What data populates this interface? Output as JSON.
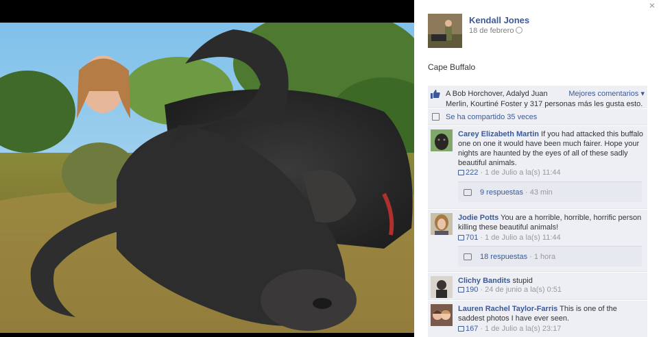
{
  "viewer": {
    "close_label": "×"
  },
  "post": {
    "author": "Kendall Jones",
    "date": "18 de febrero",
    "caption": "Cape Buffalo"
  },
  "likes": {
    "line1": "A Bob Horchover, Adalyd Juan",
    "line2": "Merlin, Kourtiné Foster y 317 personas más les gusta esto.",
    "top_comments_label": "Mejores comentarios ▾"
  },
  "shares": {
    "label": "Se ha compartido 35 veces"
  },
  "comments": [
    {
      "author": "Carey Elizabeth Martin",
      "text": " If you had attacked this buffalo one on one it would have been much fairer. Hope your nights are haunted by the eyes of all of these sadly beautiful animals.",
      "likes": "222",
      "time": " · 1 de Julio a la(s) 11:44",
      "replies": "9 respuestas",
      "replies_time": " · 43 min"
    },
    {
      "author": "Jodie Potts",
      "text": " You are a horrible, horrible, horrific person killing these beautiful animals!",
      "likes": "701",
      "time": " · 1 de Julio a la(s) 11:44",
      "replies": "18 respuestas",
      "replies_time": " · 1 hora"
    },
    {
      "author": "Clichy Bandits",
      "text": " stupid",
      "likes": "190",
      "time": " · 24 de junio a la(s) 0:51"
    },
    {
      "author": "Lauren Rachel Taylor-Farris",
      "text": " This is one of the saddest photos I have ever seen.",
      "likes": "167",
      "time": " · 1 de Julio a la(s) 23:17"
    }
  ]
}
